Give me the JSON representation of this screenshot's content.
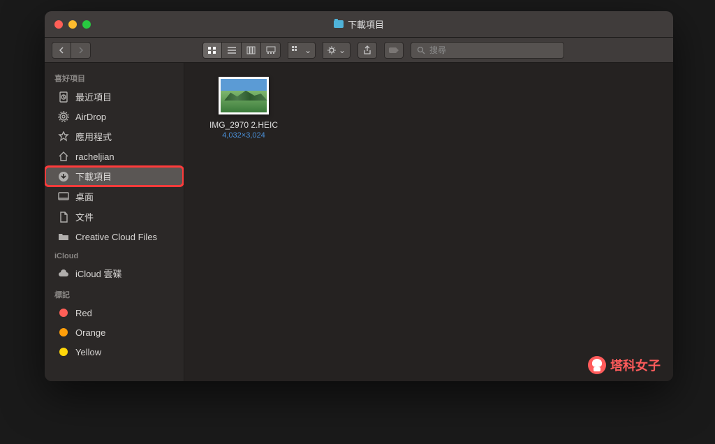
{
  "window": {
    "title": "下載項目"
  },
  "search": {
    "placeholder": "搜尋"
  },
  "sidebar": {
    "sections": [
      {
        "title": "喜好項目",
        "items": [
          {
            "label": "最近項目",
            "icon": "clock-doc-icon"
          },
          {
            "label": "AirDrop",
            "icon": "airdrop-icon"
          },
          {
            "label": "應用程式",
            "icon": "apps-icon"
          },
          {
            "label": "racheljian",
            "icon": "home-icon"
          },
          {
            "label": "下載項目",
            "icon": "downloads-icon",
            "selected": true,
            "highlighted": true
          },
          {
            "label": "桌面",
            "icon": "desktop-icon"
          },
          {
            "label": "文件",
            "icon": "documents-icon"
          },
          {
            "label": "Creative Cloud Files",
            "icon": "folder-icon"
          }
        ]
      },
      {
        "title": "iCloud",
        "items": [
          {
            "label": "iCloud 雲碟",
            "icon": "cloud-icon"
          }
        ]
      },
      {
        "title": "標記",
        "items": [
          {
            "label": "Red",
            "icon": "tag",
            "color": "#ff5f57"
          },
          {
            "label": "Orange",
            "icon": "tag",
            "color": "#ff9f0a"
          },
          {
            "label": "Yellow",
            "icon": "tag",
            "color": "#ffd60a"
          }
        ]
      }
    ]
  },
  "files": [
    {
      "name": "IMG_2970 2.HEIC",
      "dimensions": "4,032×3,024"
    }
  ],
  "watermark": "塔科女子"
}
